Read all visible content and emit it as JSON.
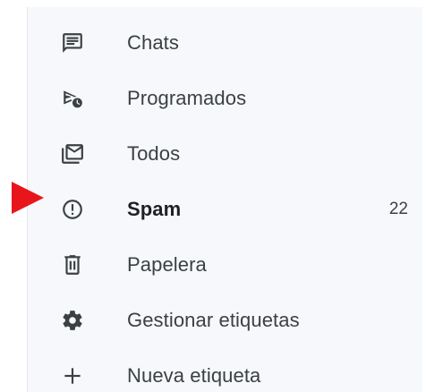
{
  "menu": {
    "items": [
      {
        "label": "Chats",
        "icon": "chat-icon"
      },
      {
        "label": "Programados",
        "icon": "scheduled-send-icon"
      },
      {
        "label": "Todos",
        "icon": "all-mail-icon"
      },
      {
        "label": "Spam",
        "icon": "report-spam-icon",
        "count": "22"
      },
      {
        "label": "Papelera",
        "icon": "trash-icon"
      },
      {
        "label": "Gestionar etiquetas",
        "icon": "settings-gear-icon"
      },
      {
        "label": "Nueva etiqueta",
        "icon": "plus-icon"
      }
    ]
  },
  "annotation": {
    "pointer_icon": "red-triangle-pointer-icon",
    "pointer_color": "#e8161b"
  },
  "colors": {
    "panel_background": "#f6f8fc",
    "text": "#3c4043",
    "icon": "#3c4043"
  }
}
